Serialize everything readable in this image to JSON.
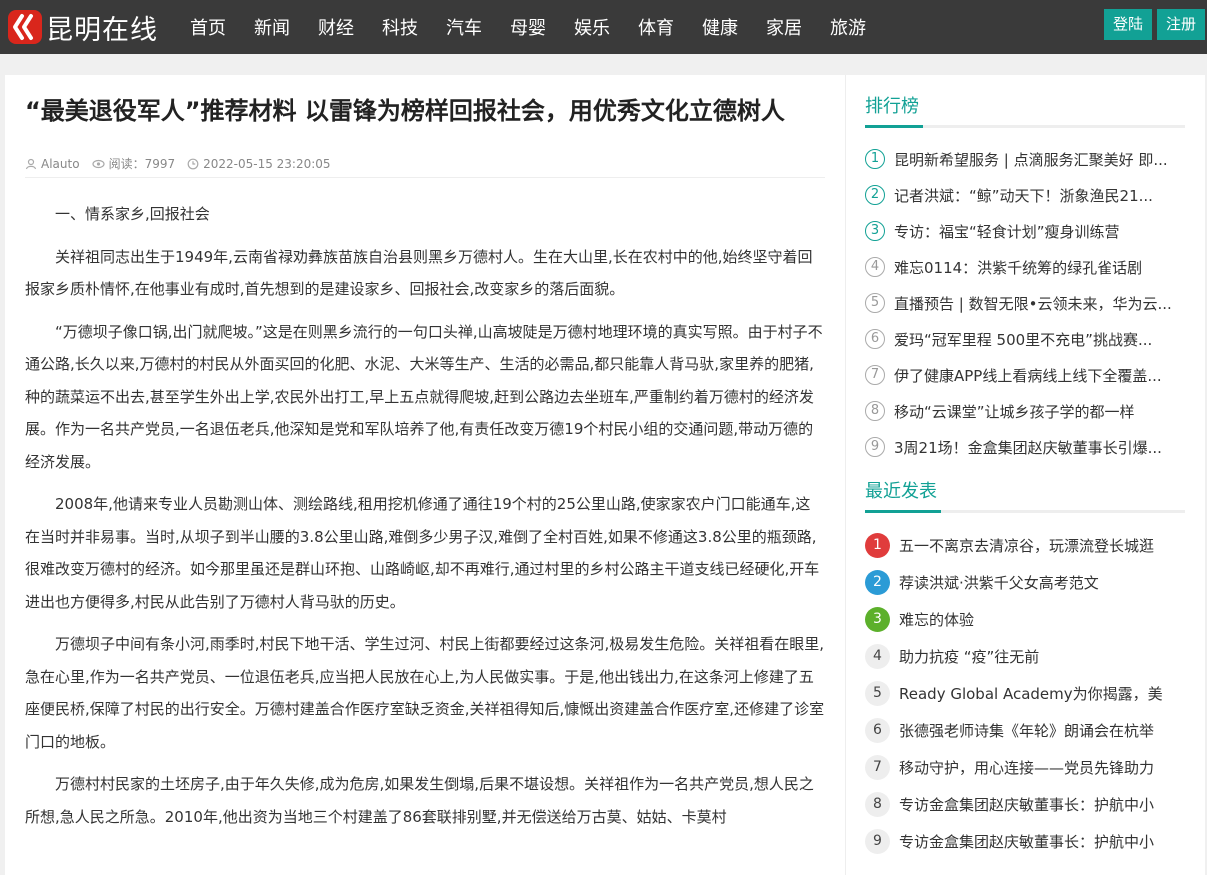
{
  "brand": {
    "name": "昆明在线"
  },
  "nav": [
    "首页",
    "新闻",
    "财经",
    "科技",
    "汽车",
    "母婴",
    "娱乐",
    "体育",
    "健康",
    "家居",
    "旅游"
  ],
  "auth": {
    "login": "登陆",
    "register": "注册"
  },
  "article": {
    "title": "“最美退役军人”推荐材料 以雷锋为榜样回报社会，用优秀文化立德树人",
    "author": "Alauto",
    "views_label": "阅读：7997",
    "date": "2022-05-15 23:20:05",
    "paragraphs": [
      "一、情系家乡,回报社会",
      "关祥祖同志出生于1949年,云南省禄劝彝族苗族自治县则黑乡万德村人。生在大山里,长在农村中的他,始终坚守着回报家乡质朴情怀,在他事业有成时,首先想到的是建设家乡、回报社会,改变家乡的落后面貌。",
      "“万德坝子像口锅,出门就爬坡。”这是在则黑乡流行的一句口头禅,山高坡陡是万德村地理环境的真实写照。由于村子不通公路,长久以来,万德村的村民从外面买回的化肥、水泥、大米等生产、生活的必需品,都只能靠人背马驮,家里养的肥猪,种的蔬菜运不出去,甚至学生外出上学,农民外出打工,早上五点就得爬坡,赶到公路边去坐班车,严重制约着万德村的经济发展。作为一名共产党员,一名退伍老兵,他深知是党和军队培养了他,有责任改变万德19个村民小组的交通问题,带动万德的经济发展。",
      "2008年,他请来专业人员勘测山体、测绘路线,租用挖机修通了通往19个村的25公里山路,使家家农户门口能通车,这在当时并非易事。当时,从坝子到半山腰的3.8公里山路,难倒多少男子汉,难倒了全村百姓,如果不修通这3.8公里的瓶颈路,很难改变万德村的经济。如今那里虽还是群山环抱、山路崎岖,却不再难行,通过村里的乡村公路主干道支线已经硬化,开车进出也方便得多,村民从此告别了万德村人背马驮的历史。",
      "万德坝子中间有条小河,雨季时,村民下地干活、学生过河、村民上街都要经过这条河,极易发生危险。关祥祖看在眼里,急在心里,作为一名共产党员、一位退伍老兵,应当把人民放在心上,为人民做实事。于是,他出钱出力,在这条河上修建了五座便民桥,保障了村民的出行安全。万德村建盖合作医疗室缺乏资金,关祥祖得知后,慷慨出资建盖合作医疗室,还修建了诊室门口的地板。",
      "万德村村民家的土坯房子,由于年久失修,成为危房,如果发生倒塌,后果不堪设想。关祥祖作为一名共产党员,想人民之所想,急人民之所急。2010年,他出资为当地三个村建盖了86套联排别墅,并无偿送给万古莫、姑姑、卡莫村"
    ]
  },
  "sidebar": {
    "ranking_title": "排行榜",
    "ranking": [
      {
        "num": "1",
        "text": "昆明新希望服务 | 点滴服务汇聚美好 即..."
      },
      {
        "num": "2",
        "text": "记者洪斌：“鲸”动天下！浙象渔民21..."
      },
      {
        "num": "3",
        "text": "专访：福宝“轻食计划”瘦身训练营"
      },
      {
        "num": "4",
        "text": "难忘0114：洪紫千统筹的绿孔雀话剧"
      },
      {
        "num": "5",
        "text": "直播预告 | 数智无限•云领未来，华为云..."
      },
      {
        "num": "6",
        "text": "爱玛“冠军里程 500里不充电”挑战赛..."
      },
      {
        "num": "7",
        "text": "伊了健康APP线上看病线上线下全覆盖..."
      },
      {
        "num": "8",
        "text": "移动“云课堂”让城乡孩子学的都一样"
      },
      {
        "num": "9",
        "text": "3周21场！金盒集团赵庆敏董事长引爆..."
      }
    ],
    "recent_title": "最近发表",
    "recent": [
      {
        "num": "1",
        "text": "五一不离京去清凉谷，玩漂流登长城逛"
      },
      {
        "num": "2",
        "text": "荐读洪斌·洪紫千父女高考范文"
      },
      {
        "num": "3",
        "text": "难忘的体验"
      },
      {
        "num": "4",
        "text": "助力抗疫 “疫”往无前"
      },
      {
        "num": "5",
        "text": "Ready Global Academy为你揭露，美"
      },
      {
        "num": "6",
        "text": "张德强老师诗集《年轮》朗诵会在杭举"
      },
      {
        "num": "7",
        "text": "移动守护，用心连接——党员先锋助力"
      },
      {
        "num": "8",
        "text": "专访金盒集团赵庆敏董事长：护航中小"
      },
      {
        "num": "9",
        "text": "专访金盒集团赵庆敏董事长：护航中小"
      }
    ],
    "recent_badge_colors": [
      "#e03c3c",
      "#2b9bd6",
      "#5cb02b"
    ]
  },
  "colors": {
    "accent": "#12a195",
    "nav_bg": "#3a3a3a"
  }
}
